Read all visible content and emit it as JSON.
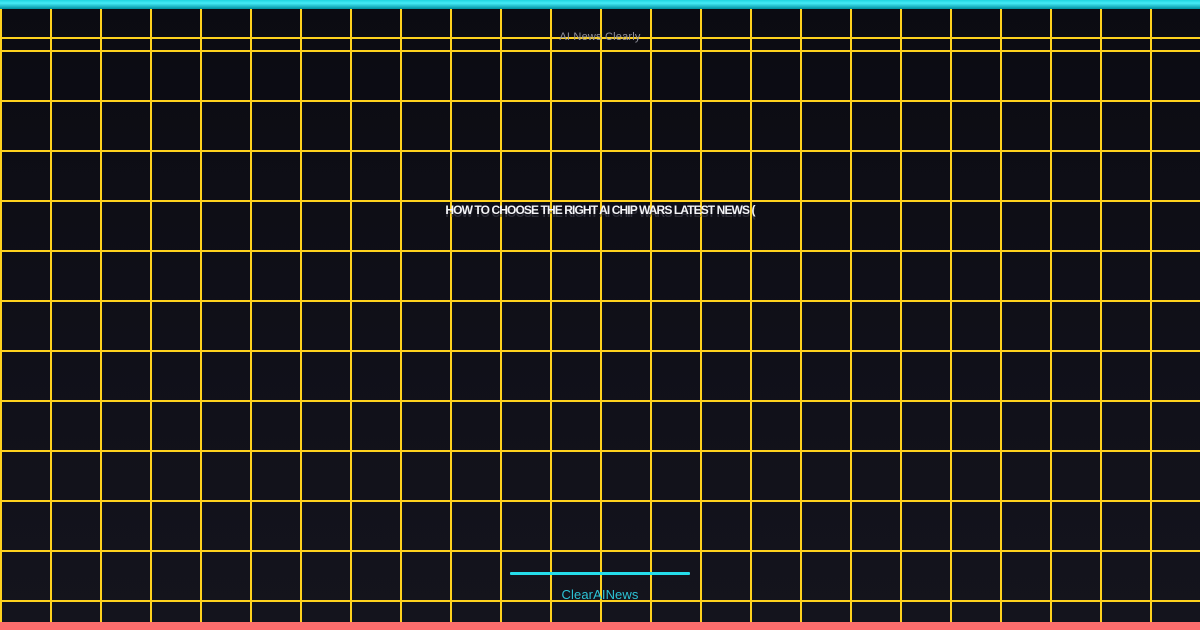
{
  "card": {
    "site_name": "AI News Clearly",
    "headline": "HOW TO CHOOSE THE RIGHT AI CHIP WARS LATEST NEWS (",
    "brand": "ClearAINews"
  },
  "theme": {
    "background_top": "#0b0b12",
    "background_bottom": "#14141d",
    "grid_line_color": "#ffd21e",
    "top_bar_cyan_light": "#45eaf5",
    "top_bar_cyan_dark": "#008fa0",
    "bottom_bar_coral": "#fb6d6d",
    "divider_cyan": "#25dcea",
    "brand_text_cyan": "#2cc3d5",
    "site_name_gray": "#94949e",
    "headline_white": "#f4f4f7"
  }
}
